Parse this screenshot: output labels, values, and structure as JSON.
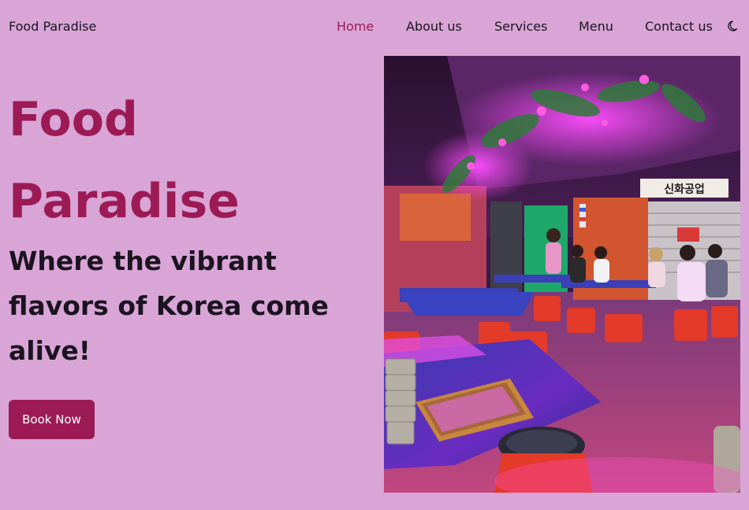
{
  "header": {
    "brand": "Food Paradise",
    "nav": [
      {
        "label": "Home",
        "active": true
      },
      {
        "label": "About us",
        "active": false
      },
      {
        "label": "Services",
        "active": false
      },
      {
        "label": "Menu",
        "active": false
      },
      {
        "label": "Contact us",
        "active": false
      }
    ],
    "theme_toggle_icon": "moon-icon"
  },
  "hero": {
    "title_line1": "Food",
    "title_line2": "Paradise",
    "tagline": "Where the vibrant flavors of Korea come alive!",
    "cta_label": "Book Now",
    "image_alt": "Neon-lit Korean restaurant interior",
    "sign_text": "신화공업"
  },
  "colors": {
    "background": "#d8a5d6",
    "accent": "#9c1b55",
    "text": "#1b1420"
  }
}
